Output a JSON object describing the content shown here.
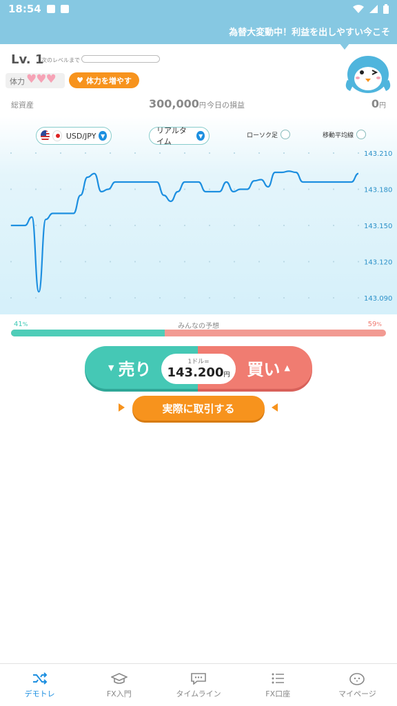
{
  "status_bar": {
    "time": "18:54"
  },
  "banner": {
    "text": "為替大変動中！利益を出しやすい今こそ"
  },
  "level": {
    "label": "Lv. 1",
    "next_level_label": "次のレベルまで",
    "xp_progress": 0
  },
  "stamina": {
    "label": "体力",
    "hearts": "♥♥♥",
    "boost_label": "体力を増やす"
  },
  "assets": {
    "total_label": "総資産",
    "total_value": "300,000",
    "total_unit": "円",
    "today_pl_label": "今日の損益",
    "today_pl_value": "0",
    "today_pl_unit": "円"
  },
  "chart_controls": {
    "pair": "USD/JPY",
    "mode": "リアルタイム",
    "candlestick_label": "ローソク足",
    "moving_average_label": "移動平均線"
  },
  "chart_data": {
    "type": "line",
    "y_ticks": [
      "143.210",
      "143.180",
      "143.150",
      "143.120",
      "143.090"
    ],
    "ylim": [
      143.09,
      143.21
    ],
    "x": [
      0,
      1,
      2,
      3,
      4,
      5,
      6,
      7,
      8,
      9,
      10,
      11,
      12,
      13,
      14,
      15,
      16,
      17,
      18,
      19,
      20,
      21,
      22,
      23,
      24,
      25,
      26,
      27,
      28,
      29,
      30,
      31,
      32,
      33,
      34,
      35,
      36,
      37,
      38,
      39,
      40,
      41,
      42,
      43,
      44,
      45,
      46,
      47,
      48,
      49,
      50
    ],
    "series": [
      {
        "values": [
          143.15,
          143.15,
          143.15,
          143.157,
          143.095,
          143.155,
          143.16,
          143.16,
          143.16,
          143.16,
          143.175,
          143.19,
          143.193,
          143.178,
          143.18,
          143.186,
          143.186,
          143.186,
          143.186,
          143.186,
          143.186,
          143.186,
          143.175,
          143.17,
          143.178,
          143.186,
          143.186,
          143.186,
          143.178,
          143.178,
          143.178,
          143.186,
          143.178,
          143.18,
          143.18,
          143.187,
          143.188,
          143.182,
          143.194,
          143.194,
          143.195,
          143.194,
          143.186,
          143.186,
          143.186,
          143.186,
          143.186,
          143.186,
          143.186,
          143.186,
          143.193
        ]
      }
    ],
    "grid": true
  },
  "prediction": {
    "title": "みんなの予想",
    "sell_pct": "41",
    "buy_pct": "59",
    "pct_unit": "%",
    "sell_fraction": 0.41
  },
  "trade": {
    "sell_label": "売り",
    "buy_label": "買い",
    "price_caption": "1ドル=",
    "price_value": "143.200",
    "price_unit": "円",
    "real_trade_label": "実際に取引する"
  },
  "bottom_nav": [
    {
      "label": "デモトレ",
      "icon": "shuffle-icon",
      "active": true
    },
    {
      "label": "FX入門",
      "icon": "graduation-cap-icon",
      "active": false
    },
    {
      "label": "タイムライン",
      "icon": "chat-bubble-icon",
      "active": false
    },
    {
      "label": "FX口座",
      "icon": "list-icon",
      "active": false
    },
    {
      "label": "マイページ",
      "icon": "mascot-face-icon",
      "active": false
    }
  ],
  "colors": {
    "accent_blue": "#1d8fe0",
    "sell_teal": "#45c8b5",
    "buy_red": "#f07c71",
    "orange": "#f7931d",
    "banner_blue": "#86c8e2"
  }
}
